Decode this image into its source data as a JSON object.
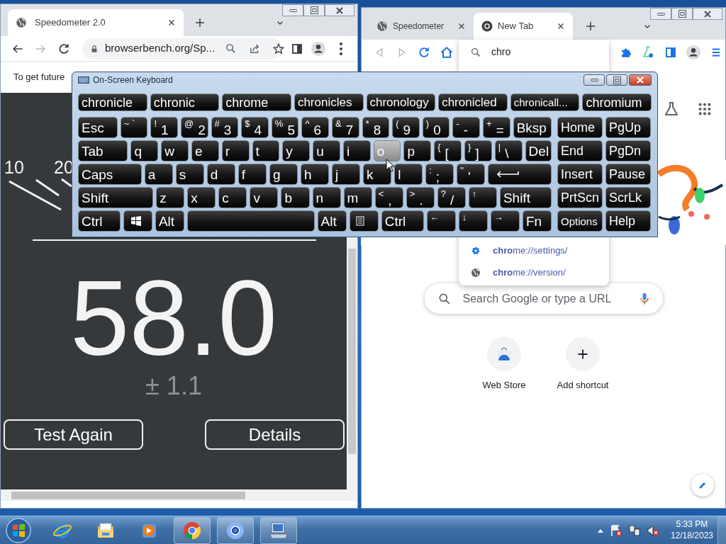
{
  "left_browser": {
    "tabs": [
      {
        "title": "Speedometer 2.0",
        "selected": true
      }
    ],
    "url": "browserbench.org/Sp...",
    "notice": "To get future",
    "gauge_labels": [
      "10",
      "20"
    ],
    "score": "58.0",
    "margin": "± 1.1",
    "buttons": [
      "Test Again",
      "Details"
    ]
  },
  "right_browser": {
    "tabs": [
      {
        "title": "Speedometer",
        "selected": false
      },
      {
        "title": "New Tab",
        "selected": true
      }
    ],
    "omnibox": {
      "value": "chro"
    },
    "suggestions": [
      {
        "text": "**chro**me://settings/",
        "kind": "settings"
      },
      {
        "text": "**chro**me://version/",
        "kind": "page"
      }
    ],
    "search": {
      "placeholder": "Search Google or type a URL"
    },
    "shortcuts": [
      {
        "label": "Web Store",
        "kind": "store"
      },
      {
        "label": "Add shortcut",
        "kind": "add"
      }
    ]
  },
  "keyboard": {
    "title": "On-Screen Keyboard",
    "predictions": [
      "chronicle",
      "chronic",
      "chrome",
      "chronicles",
      "chronology",
      "chronicled",
      "chronicall...",
      "chromium"
    ],
    "rows": [
      {
        "keys": [
          {
            "label": "Esc",
            "highlighted": false
          },
          {
            "top": "~ `",
            "highlighted": false
          },
          {
            "top": "!",
            "label": "1",
            "highlighted": false
          },
          {
            "top": "@",
            "label": "2",
            "highlighted": false
          },
          {
            "top": "#",
            "label": "3",
            "highlighted": false
          },
          {
            "top": "$",
            "label": "4",
            "highlighted": false
          },
          {
            "top": "%",
            "label": "5",
            "highlighted": false
          },
          {
            "top": "^",
            "label": "6",
            "highlighted": false
          },
          {
            "top": "&",
            "label": "7",
            "highlighted": false
          },
          {
            "top": "*",
            "label": "8",
            "highlighted": false
          },
          {
            "top": "(",
            "label": "9",
            "highlighted": false
          },
          {
            "top": ")",
            "label": "0",
            "highlighted": false
          },
          {
            "top": "-",
            "label": "-",
            "highlighted": false
          },
          {
            "top": "+",
            "label": "=",
            "highlighted": false
          },
          {
            "label": "Bksp",
            "highlighted": false
          }
        ],
        "nav": [
          {
            "label": "Home",
            "highlighted": false
          },
          {
            "label": "PgUp",
            "highlighted": false
          }
        ]
      },
      {
        "keys": [
          {
            "label": "Tab",
            "highlighted": false
          },
          {
            "label": "q",
            "highlighted": false
          },
          {
            "label": "w",
            "highlighted": false
          },
          {
            "label": "e",
            "highlighted": false
          },
          {
            "label": "r",
            "highlighted": false
          },
          {
            "label": "t",
            "highlighted": false
          },
          {
            "label": "y",
            "highlighted": false
          },
          {
            "label": "u",
            "highlighted": false
          },
          {
            "label": "i",
            "highlighted": false
          },
          {
            "label": "o",
            "highlighted": true
          },
          {
            "label": "p",
            "highlighted": false
          },
          {
            "top": "{",
            "label": "[",
            "highlighted": false
          },
          {
            "top": "}",
            "label": "]",
            "highlighted": false
          },
          {
            "top": "|",
            "label": "\\",
            "highlighted": false
          },
          {
            "label": "Del",
            "highlighted": false
          }
        ],
        "nav": [
          {
            "label": "End",
            "highlighted": false
          },
          {
            "label": "PgDn",
            "highlighted": false
          }
        ]
      },
      {
        "keys": [
          {
            "label": "Caps",
            "highlighted": false
          },
          {
            "label": "a",
            "highlighted": false
          },
          {
            "label": "s",
            "highlighted": false
          },
          {
            "label": "d",
            "highlighted": false
          },
          {
            "label": "f",
            "highlighted": false
          },
          {
            "label": "g",
            "highlighted": false
          },
          {
            "label": "h",
            "highlighted": false
          },
          {
            "label": "j",
            "highlighted": false
          },
          {
            "label": "k",
            "highlighted": false
          },
          {
            "label": "l",
            "highlighted": false
          },
          {
            "top": ":",
            "label": ";",
            "highlighted": false
          },
          {
            "top": "\"",
            "label": "'",
            "highlighted": false
          },
          {
            "kind": "enter",
            "highlighted": false
          }
        ],
        "nav": [
          {
            "label": "Insert",
            "highlighted": false
          },
          {
            "label": "Pause",
            "highlighted": false
          }
        ]
      },
      {
        "keys": [
          {
            "label": "Shift",
            "highlighted": false
          },
          {
            "label": "z",
            "highlighted": false
          },
          {
            "label": "x",
            "highlighted": false
          },
          {
            "label": "c",
            "highlighted": false
          },
          {
            "label": "v",
            "highlighted": false
          },
          {
            "label": "b",
            "highlighted": false
          },
          {
            "label": "n",
            "highlighted": false
          },
          {
            "label": "m",
            "highlighted": false
          },
          {
            "top": "<",
            "label": ",",
            "highlighted": false
          },
          {
            "top": ">",
            "label": ".",
            "highlighted": false
          },
          {
            "top": "?",
            "label": "/",
            "highlighted": false
          },
          {
            "top": "↑",
            "highlighted": false
          },
          {
            "label": "Shift",
            "highlighted": false
          }
        ],
        "nav": [
          {
            "label": "PrtScn",
            "highlighted": false
          },
          {
            "label": "ScrLk",
            "highlighted": false
          }
        ]
      },
      {
        "keys": [
          {
            "label": "Ctrl",
            "highlighted": false
          },
          {
            "kind": "windows",
            "highlighted": false
          },
          {
            "label": "Alt",
            "highlighted": false
          },
          {
            "kind": "space",
            "highlighted": false
          },
          {
            "label": "Alt",
            "highlighted": false
          },
          {
            "kind": "menu",
            "highlighted": false
          },
          {
            "label": "Ctrl",
            "highlighted": false
          },
          {
            "top": "←",
            "highlighted": false
          },
          {
            "top": "↓",
            "highlighted": false
          },
          {
            "top": "→",
            "highlighted": false
          },
          {
            "label": "Fn",
            "highlighted": false
          }
        ],
        "nav": [
          {
            "label": "Options",
            "highlighted": false
          },
          {
            "label": "Help",
            "highlighted": false
          }
        ]
      }
    ]
  },
  "taskbar": {
    "apps": [
      {
        "kind": "ie",
        "open": false
      },
      {
        "kind": "explorer",
        "open": false
      },
      {
        "kind": "media",
        "open": false
      },
      {
        "kind": "chrome",
        "open": true
      },
      {
        "kind": "chromium",
        "open": true
      },
      {
        "kind": "keyboard",
        "open": true
      }
    ],
    "time": "5:33 PM",
    "date": "12/18/2023"
  }
}
